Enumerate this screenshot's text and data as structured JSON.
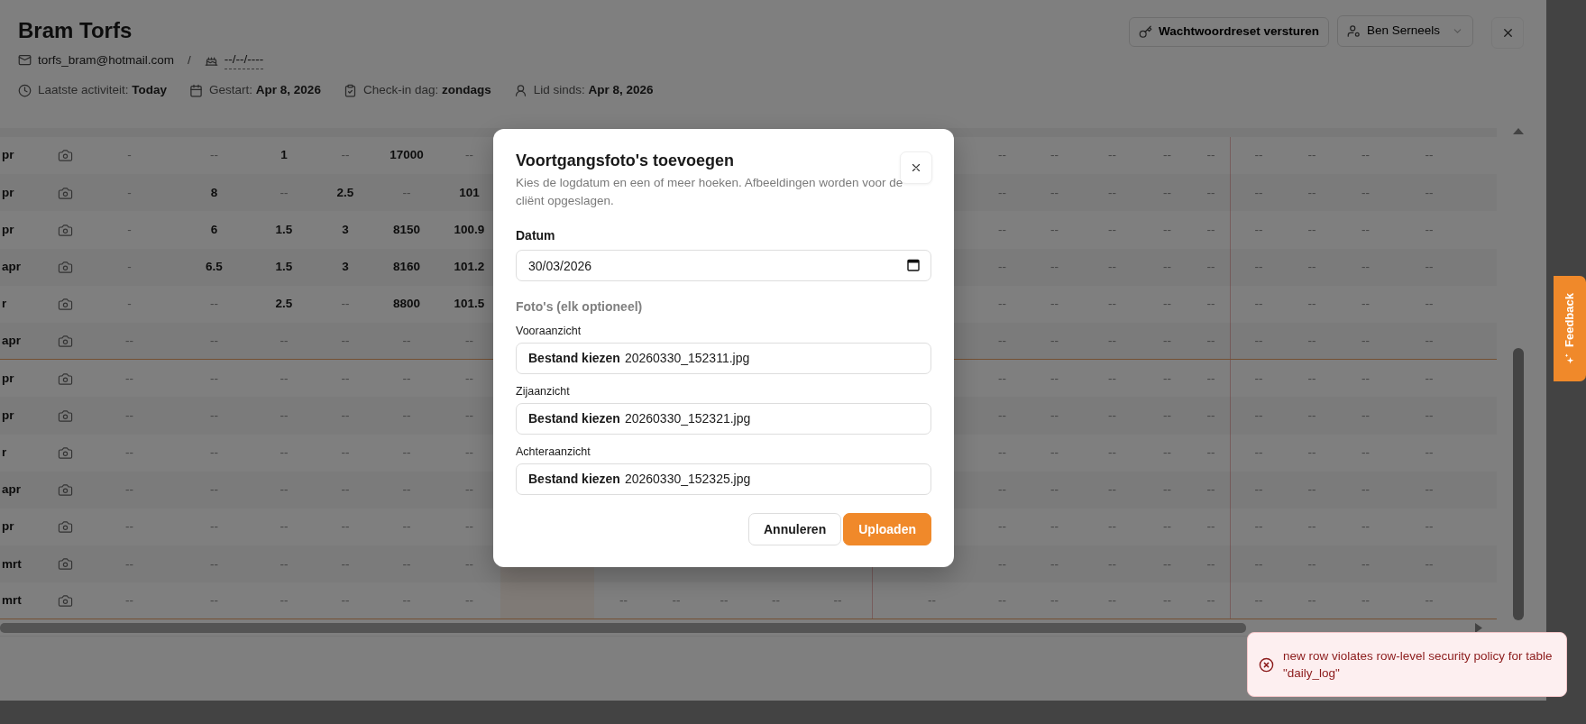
{
  "profile": {
    "name": "Bram Torfs",
    "email": "torfs_bram@hotmail.com",
    "separator": "/",
    "birthdate": "--/--/----",
    "stats": [
      {
        "label": "Laatste activiteit:",
        "value": "Today"
      },
      {
        "label": "Gestart:",
        "value": "Apr 8, 2026"
      },
      {
        "label": "Check-in dag:",
        "value": "zondags"
      },
      {
        "label": "Lid sinds:",
        "value": "Apr 8, 2026"
      }
    ]
  },
  "header_actions": {
    "reset_button": "Wachtwoordreset versturen",
    "coach_select": "Ben Serneels"
  },
  "table": {
    "rows": [
      {
        "date": "pr",
        "divider_below": false,
        "left": [
          {
            "text": "-",
            "filled": false
          },
          {
            "text": "--",
            "filled": false
          },
          {
            "text": "1",
            "filled": true
          },
          {
            "text": "--",
            "filled": false
          },
          {
            "text": "17000",
            "filled": true
          },
          {
            "text": "--",
            "filled": false
          }
        ],
        "right": [
          "--",
          "--",
          "--",
          "--",
          "--",
          "--",
          "--",
          "--",
          "--"
        ]
      },
      {
        "date": "pr",
        "divider_below": false,
        "left": [
          {
            "text": "-",
            "filled": false
          },
          {
            "text": "8",
            "filled": true
          },
          {
            "text": "--",
            "filled": false
          },
          {
            "text": "2.5",
            "filled": true
          },
          {
            "text": "--",
            "filled": false
          },
          {
            "text": "101",
            "filled": true
          }
        ],
        "right": [
          "--",
          "--",
          "--",
          "--",
          "--",
          "--",
          "--",
          "--",
          "--"
        ]
      },
      {
        "date": "pr",
        "divider_below": false,
        "left": [
          {
            "text": "-",
            "filled": false
          },
          {
            "text": "6",
            "filled": true
          },
          {
            "text": "1.5",
            "filled": true
          },
          {
            "text": "3",
            "filled": true
          },
          {
            "text": "8150",
            "filled": true
          },
          {
            "text": "100.9",
            "filled": true
          }
        ],
        "right": [
          "--",
          "--",
          "--",
          "--",
          "--",
          "--",
          "--",
          "--",
          "--"
        ]
      },
      {
        "date": "apr",
        "divider_below": false,
        "left": [
          {
            "text": "-",
            "filled": false
          },
          {
            "text": "6.5",
            "filled": true
          },
          {
            "text": "1.5",
            "filled": true
          },
          {
            "text": "3",
            "filled": true
          },
          {
            "text": "8160",
            "filled": true
          },
          {
            "text": "101.2",
            "filled": true
          }
        ],
        "right": [
          "--",
          "--",
          "--",
          "--",
          "--",
          "--",
          "--",
          "--",
          "--"
        ]
      },
      {
        "date": "r",
        "divider_below": false,
        "left": [
          {
            "text": "-",
            "filled": false
          },
          {
            "text": "--",
            "filled": false
          },
          {
            "text": "2.5",
            "filled": true
          },
          {
            "text": "--",
            "filled": false
          },
          {
            "text": "8800",
            "filled": true
          },
          {
            "text": "101.5",
            "filled": true
          }
        ],
        "right": [
          "--",
          "--",
          "--",
          "--",
          "--",
          "--",
          "--",
          "--",
          "--"
        ]
      },
      {
        "date": "apr",
        "divider_below": true,
        "left": [
          {
            "text": "--",
            "filled": false
          },
          {
            "text": "--",
            "filled": false
          },
          {
            "text": "--",
            "filled": false
          },
          {
            "text": "--",
            "filled": false
          },
          {
            "text": "--",
            "filled": false
          },
          {
            "text": "--",
            "filled": false
          }
        ],
        "right": [
          "--",
          "--",
          "--",
          "--",
          "--",
          "--",
          "--",
          "--",
          "--"
        ]
      },
      {
        "date": "pr",
        "divider_below": false,
        "left": [
          {
            "text": "--",
            "filled": false
          },
          {
            "text": "--",
            "filled": false
          },
          {
            "text": "--",
            "filled": false
          },
          {
            "text": "--",
            "filled": false
          },
          {
            "text": "--",
            "filled": false
          },
          {
            "text": "--",
            "filled": false
          }
        ],
        "right": [
          "--",
          "--",
          "--",
          "--",
          "--",
          "--",
          "--",
          "--",
          "--"
        ]
      },
      {
        "date": "pr",
        "divider_below": false,
        "left": [
          {
            "text": "--",
            "filled": false
          },
          {
            "text": "--",
            "filled": false
          },
          {
            "text": "--",
            "filled": false
          },
          {
            "text": "--",
            "filled": false
          },
          {
            "text": "--",
            "filled": false
          },
          {
            "text": "--",
            "filled": false
          }
        ],
        "right": [
          "--",
          "--",
          "--",
          "--",
          "--",
          "--",
          "--",
          "--",
          "--"
        ]
      },
      {
        "date": "r",
        "divider_below": false,
        "left": [
          {
            "text": "--",
            "filled": false
          },
          {
            "text": "--",
            "filled": false
          },
          {
            "text": "--",
            "filled": false
          },
          {
            "text": "--",
            "filled": false
          },
          {
            "text": "--",
            "filled": false
          },
          {
            "text": "--",
            "filled": false
          }
        ],
        "right": [
          "--",
          "--",
          "--",
          "--",
          "--",
          "--",
          "--",
          "--",
          "--"
        ]
      },
      {
        "date": "apr",
        "divider_below": false,
        "left": [
          {
            "text": "--",
            "filled": false
          },
          {
            "text": "--",
            "filled": false
          },
          {
            "text": "--",
            "filled": false
          },
          {
            "text": "--",
            "filled": false
          },
          {
            "text": "--",
            "filled": false
          },
          {
            "text": "--",
            "filled": false
          }
        ],
        "right": [
          "--",
          "--",
          "--",
          "--",
          "--",
          "--",
          "--",
          "--",
          "--"
        ]
      },
      {
        "date": "pr",
        "divider_below": false,
        "left": [
          {
            "text": "--",
            "filled": false
          },
          {
            "text": "--",
            "filled": false
          },
          {
            "text": "--",
            "filled": false
          },
          {
            "text": "--",
            "filled": false
          },
          {
            "text": "--",
            "filled": false
          },
          {
            "text": "--",
            "filled": false
          }
        ],
        "right": [
          "--",
          "--",
          "--",
          "--",
          "--",
          "--",
          "--",
          "--",
          "--"
        ]
      },
      {
        "date": "mrt",
        "divider_below": false,
        "left": [
          {
            "text": "--",
            "filled": false
          },
          {
            "text": "--",
            "filled": false
          },
          {
            "text": "--",
            "filled": false
          },
          {
            "text": "--",
            "filled": false
          },
          {
            "text": "--",
            "filled": false
          },
          {
            "text": "--",
            "filled": false
          }
        ],
        "right": [
          "--",
          "--",
          "--",
          "--",
          "--",
          "--",
          "--",
          "--",
          "--"
        ]
      },
      {
        "date": "mrt",
        "divider_below": true,
        "left": [
          {
            "text": "--",
            "filled": false
          },
          {
            "text": "--",
            "filled": false
          },
          {
            "text": "--",
            "filled": false
          },
          {
            "text": "--",
            "filled": false
          },
          {
            "text": "--",
            "filled": false
          },
          {
            "text": "--",
            "filled": false
          }
        ],
        "middle": [
          "--",
          "--",
          "--",
          "--",
          "--",
          "--"
        ],
        "right": [
          "--",
          "--",
          "--",
          "--",
          "--",
          "--",
          "--",
          "--",
          "--"
        ]
      }
    ]
  },
  "dialog": {
    "title": "Voortgangsfoto's toevoegen",
    "description": "Kies de logdatum en een of meer hoeken. Afbeeldingen worden voor de cliënt opgeslagen.",
    "date_label": "Datum",
    "date_value": "30/03/2026",
    "photos_heading": "Foto's (elk optioneel)",
    "photos": [
      {
        "label": "Vooraanzicht",
        "button": "Bestand kiezen",
        "file": "20260330_152311.jpg"
      },
      {
        "label": "Zijaanzicht",
        "button": "Bestand kiezen",
        "file": "20260330_152321.jpg"
      },
      {
        "label": "Achteraanzicht",
        "button": "Bestand kiezen",
        "file": "20260330_152325.jpg"
      }
    ],
    "buttons": [
      {
        "label": "Annuleren",
        "kind": "secondary"
      },
      {
        "label": "Uploaden",
        "kind": "primary"
      }
    ]
  },
  "toast": {
    "kind": "error",
    "message": "new row violates row-level security policy for table \"daily_log\""
  },
  "feedback_tab": {
    "label": "Feedback"
  }
}
